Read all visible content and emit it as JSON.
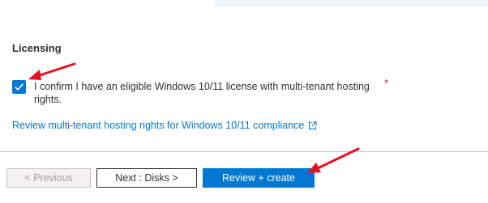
{
  "licensing": {
    "title": "Licensing",
    "confirm_text": "I confirm I have an eligible Windows 10/11 license with multi-tenant hosting rights.",
    "required_marker": "*",
    "checked": true,
    "link_text": "Review multi-tenant hosting rights for Windows 10/11 compliance",
    "link_icon": "external-link-icon"
  },
  "footer": {
    "previous_label": "< Previous",
    "next_label": "Next : Disks >",
    "review_label": "Review + create"
  },
  "colors": {
    "accent": "#0078d4",
    "annotation_arrow": "#e81123",
    "required": "#a4262c"
  }
}
